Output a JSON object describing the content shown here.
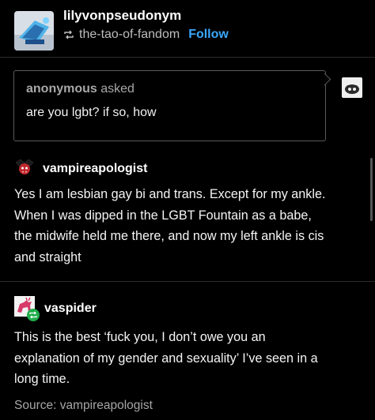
{
  "header": {
    "blog_name": "lilyvonpseudonym",
    "reblogged_from": "the-tao-of-fandom",
    "follow_label": "Follow"
  },
  "ask": {
    "asker": "anonymous",
    "asked_label": "asked",
    "question": "are you lgbt? if so, how"
  },
  "posts": [
    {
      "author": "vampireapologist",
      "lines": [
        "Yes I am lesbian gay bi and trans. Except for my ankle.",
        "When I was dipped in the LGBT Fountain as a babe,",
        "the midwife held me there, and now my left ankle is cis",
        "and straight"
      ]
    },
    {
      "author": "vaspider",
      "lines": [
        "This is the best ‘fuck you, I don’t owe you an",
        "explanation of my gender and sexuality’ I’ve seen in a",
        "long time."
      ]
    }
  ],
  "source": "Source: vampireapologist",
  "colors": {
    "background": "#000000",
    "follow": "#3aa8ff",
    "muted_text": "#a6a6a6",
    "reblog_badge": "#1fad4b"
  }
}
